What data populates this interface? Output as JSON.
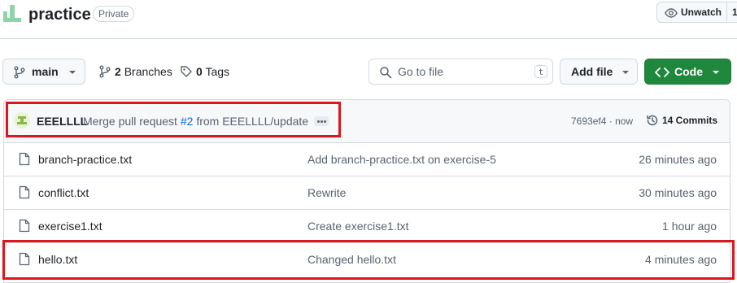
{
  "header": {
    "repo_icon": "repo-avatar-icon",
    "repo_name": "practice",
    "visibility_badge": "Private",
    "unwatch_label": "Unwatch",
    "unwatch_count": "1"
  },
  "toolbar": {
    "branch_label": "main",
    "branches_count": "2",
    "branches_label": "Branches",
    "tags_count": "0",
    "tags_label": "Tags",
    "search_placeholder": "Go to file",
    "search_shortcut": "t",
    "add_file_label": "Add file",
    "code_label": "Code"
  },
  "latest_commit": {
    "author": "EEELLLL",
    "message_prefix": "Merge pull request",
    "pr_number": "#2",
    "message_suffix": "from EEELLLL/update",
    "sha": "7693ef4",
    "separator": "·",
    "time": "now",
    "commits_label": "14 Commits"
  },
  "files": [
    {
      "name": "branch-practice.txt",
      "message": "Add branch-practice.txt on exercise-5",
      "age": "26 minutes ago"
    },
    {
      "name": "conflict.txt",
      "message": "Rewrite",
      "age": "30 minutes ago"
    },
    {
      "name": "exercise1.txt",
      "message": "Create exercise1.txt",
      "age": "1 hour ago"
    },
    {
      "name": "hello.txt",
      "message": "Changed hello.txt",
      "age": "4 minutes ago"
    }
  ],
  "colors": {
    "highlight": "#e0141b",
    "code_button": "#1f883d",
    "link": "#0969da"
  }
}
